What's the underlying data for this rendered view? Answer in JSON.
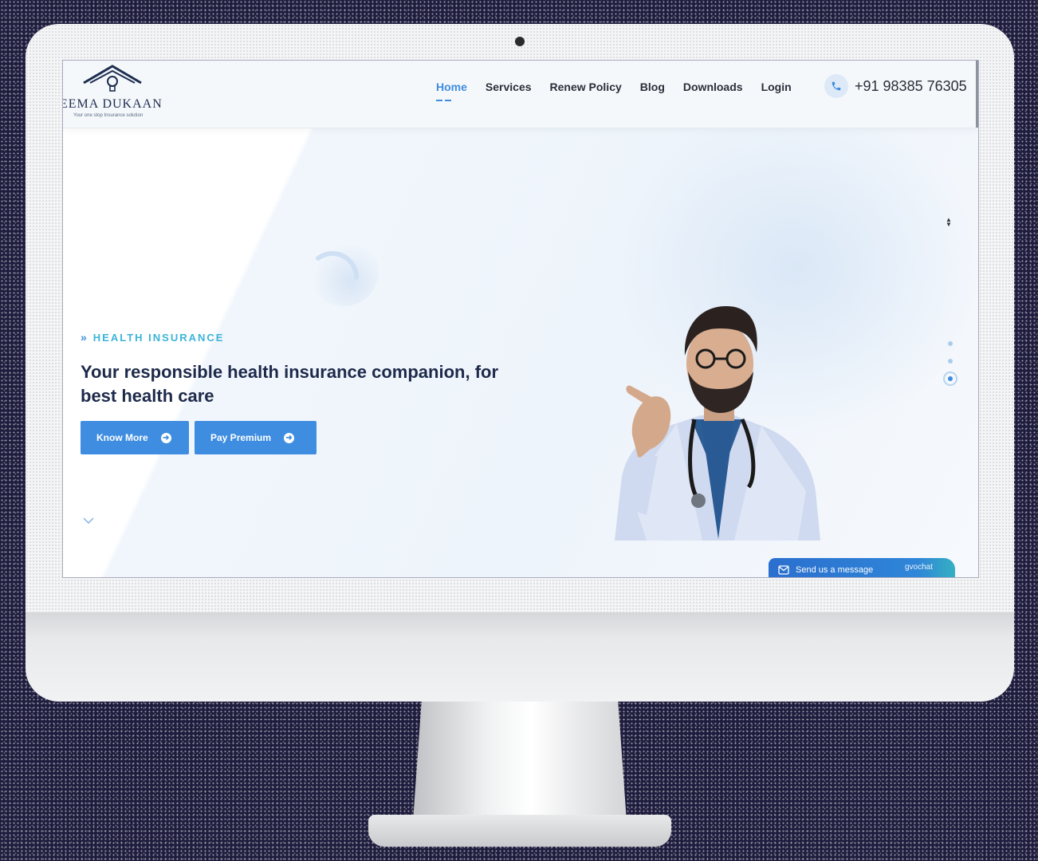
{
  "brand": {
    "name": "EEMA DUKAAN",
    "tagline": "Your one stop Insurance solution"
  },
  "nav": {
    "items": [
      {
        "label": "Home",
        "active": true
      },
      {
        "label": "Services",
        "active": false
      },
      {
        "label": "Renew Policy",
        "active": false
      },
      {
        "label": "Blog",
        "active": false
      },
      {
        "label": "Downloads",
        "active": false
      },
      {
        "label": "Login",
        "active": false
      }
    ]
  },
  "contact": {
    "phone": "+91 98385 76305",
    "icon": "phone-icon"
  },
  "hero": {
    "eyebrow": "HEALTH INSURANCE",
    "headline": "Your responsible health insurance companion, for best health care",
    "buttons": [
      {
        "label": "Know More",
        "icon": "arrow-right-circle-icon"
      },
      {
        "label": "Pay Premium",
        "icon": "arrow-right-circle-icon"
      }
    ]
  },
  "chat_widget": {
    "label": "Send us a message",
    "brand": "gvochat"
  },
  "colors": {
    "accent": "#3e8de0",
    "eyebrow": "#3bb4d8",
    "heading": "#1d2a4a",
    "backdrop": "#1f1d3e"
  }
}
